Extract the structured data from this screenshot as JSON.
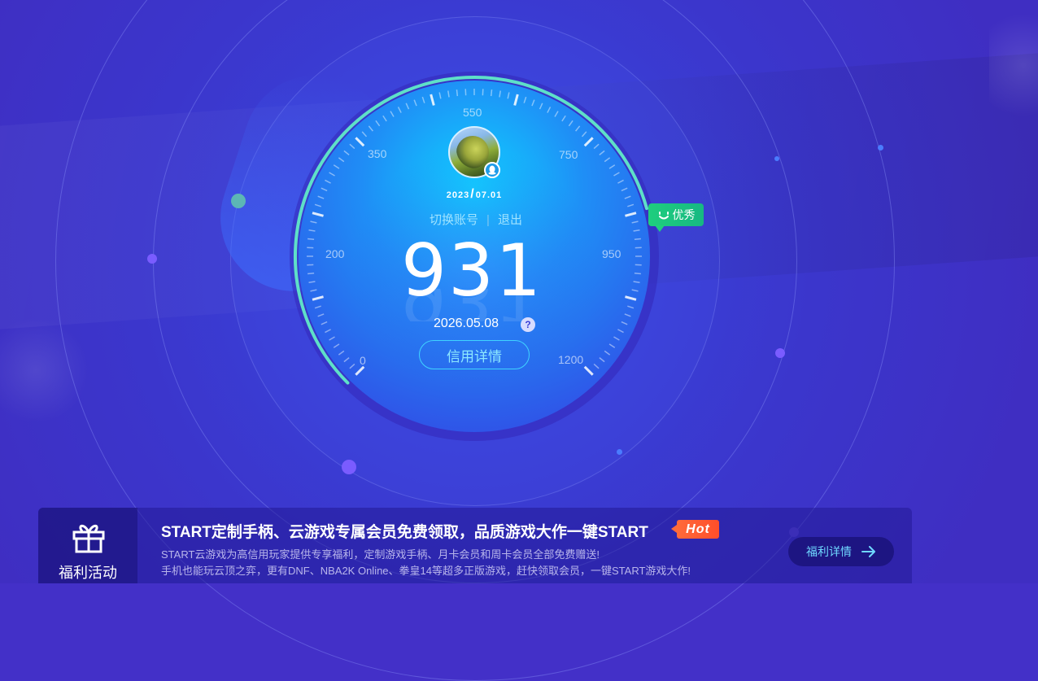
{
  "profile": {
    "date_year": "2023",
    "date_monthday": "07.01",
    "switch_account": "切换账号",
    "separator": "|",
    "logout": "退出"
  },
  "credit": {
    "score": 931,
    "score_text": "931",
    "date": "2026.05.08",
    "help_label": "?",
    "details_button": "信用详情",
    "rating": "优秀",
    "scale_min": 0,
    "scale_max": 1200,
    "gauge_labels": [
      "0",
      "200",
      "350",
      "550",
      "750",
      "950",
      "1200"
    ]
  },
  "banner": {
    "label": "福利活动",
    "title": "START定制手柄、云游戏专属会员免费领取，品质游戏大作一键START",
    "hot": "Hot",
    "desc_line1": "START云游戏为高信用玩家提供专享福利，定制游戏手柄、月卡会员和周卡会员全部免费赠送!",
    "desc_line2": "手机也能玩云顶之弈，更有DNF、NBA2K Online、拳皇14等超多正版游戏，赶快领取会员，一键START游戏大作!",
    "button": "福利详情"
  },
  "colors": {
    "background": "#4330c8",
    "accent_cyan": "#3fd3ff",
    "rating_green": "#1fce7e",
    "hot_orange": "#ff5a32"
  }
}
